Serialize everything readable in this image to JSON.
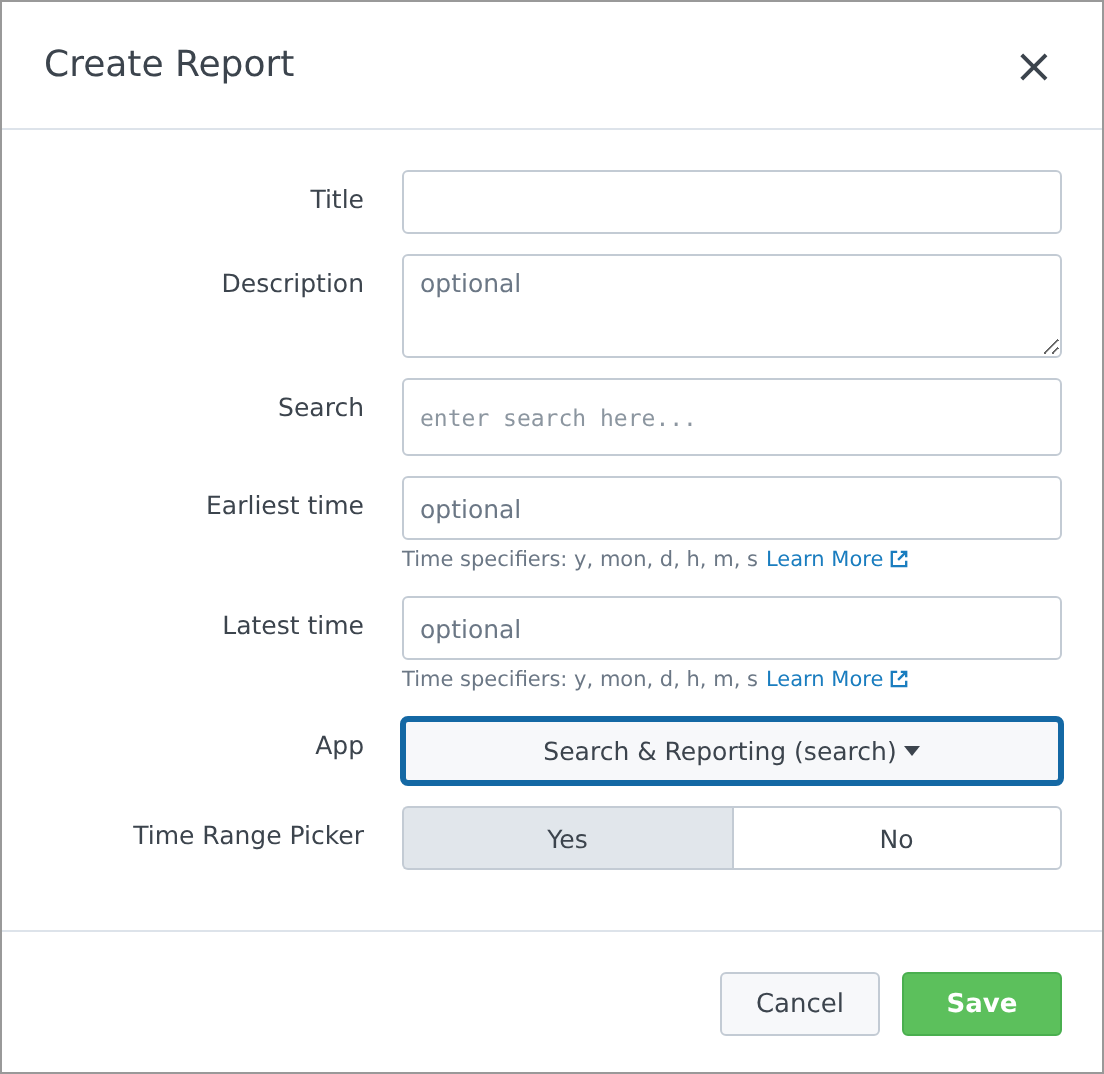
{
  "dialog": {
    "title": "Create Report",
    "close": "×"
  },
  "fields": [
    {
      "kind": "text",
      "label": "Title"
    },
    {
      "kind": "textarea",
      "label": "Description",
      "placeholder": "optional"
    },
    {
      "kind": "code",
      "label": "Search",
      "placeholder": "enter search here..."
    },
    {
      "kind": "text",
      "label": "Earliest time",
      "placeholder": "optional",
      "help": "Time specifiers: y, mon, d, h, m, s",
      "link": "Learn More"
    },
    {
      "kind": "text",
      "label": "Latest time",
      "placeholder": "optional",
      "help": "Time specifiers: y, mon, d, h, m, s",
      "link": "Learn More"
    },
    {
      "kind": "dropdown",
      "label": "App",
      "value": "Search & Reporting (search)",
      "focused": true
    },
    {
      "kind": "toggle",
      "label": "Time Range Picker",
      "options": [
        {
          "label": "Yes",
          "selected": true
        },
        {
          "label": "No",
          "selected": false
        }
      ]
    }
  ],
  "buttons": [
    {
      "kind": "secondary",
      "label": "Cancel"
    },
    {
      "kind": "primary",
      "label": "Save"
    }
  ]
}
